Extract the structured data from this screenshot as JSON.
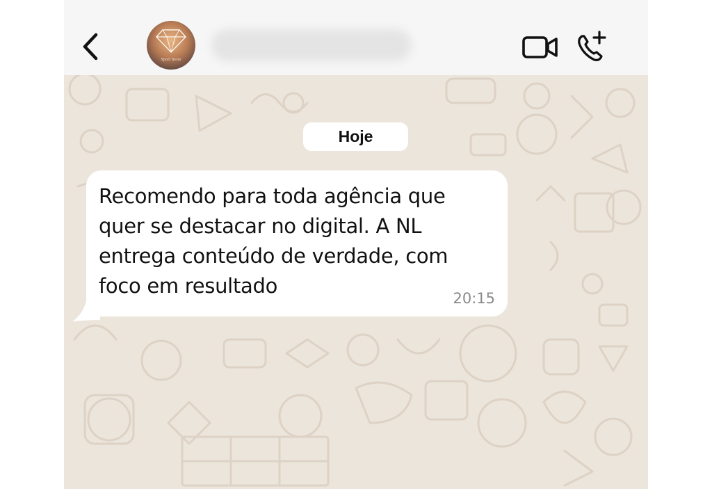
{
  "header": {
    "back_icon": "chevron-left-icon",
    "contact_name": "",
    "avatar_caption": "Sport Store",
    "video_icon": "video-camera-icon",
    "call_icon": "phone-plus-icon"
  },
  "chat": {
    "date_label": "Hoje",
    "messages": [
      {
        "text": "Recomendo para toda agência que quer se destacar no digital. A NL entrega conteúdo de verdade, com foco em resultado",
        "time": "20:15",
        "direction": "incoming"
      }
    ]
  },
  "colors": {
    "header_bg": "#f6f6f6",
    "chat_bg": "#ece5dc",
    "bubble_bg": "#ffffff",
    "text": "#111111",
    "timestamp": "#8a8a8a"
  }
}
